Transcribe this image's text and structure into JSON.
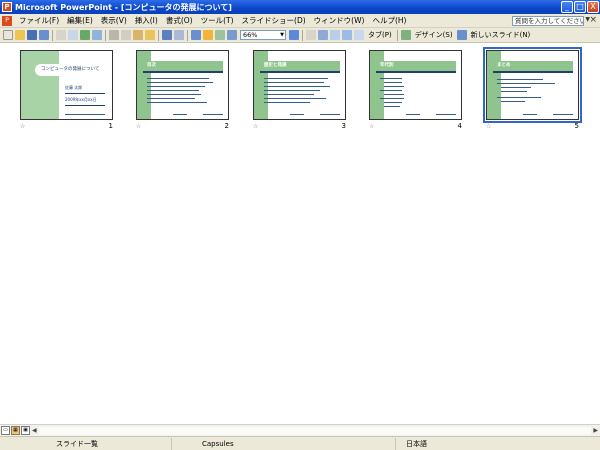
{
  "window": {
    "title": "Microsoft PowerPoint - [コンピュータの発展について]",
    "minimize": "_",
    "maximize": "□",
    "close": "X"
  },
  "menu": {
    "items": [
      "ファイル(F)",
      "編集(E)",
      "表示(V)",
      "挿入(I)",
      "書式(O)",
      "ツール(T)",
      "スライドショー(D)",
      "ウィンドウ(W)",
      "ヘルプ(H)"
    ],
    "help_placeholder": "質問を入力してください",
    "doc_close": "×"
  },
  "toolbar": {
    "zoom": "66%",
    "design_label": "デザイン(S)",
    "new_slide_label": "新しいスライド(N)",
    "tabs_label": "タブ(P)"
  },
  "colors": {
    "accent_green": "#8fc48f",
    "title_blue": "#0b47c9",
    "selection": "#3366cc"
  },
  "slides": [
    {
      "number": "1",
      "title": "コンピュータの発展について",
      "subtitle1": "佐藤 太郎",
      "subtitle2": "2009年xx月xx日"
    },
    {
      "number": "2",
      "title": "目次"
    },
    {
      "number": "3",
      "title": "歴史と発展"
    },
    {
      "number": "4",
      "title": "年代別"
    },
    {
      "number": "5",
      "title": "まとめ"
    }
  ],
  "status": {
    "slide_sorter": "スライド一覧",
    "design_name": "Capsules",
    "language": "日本語"
  }
}
